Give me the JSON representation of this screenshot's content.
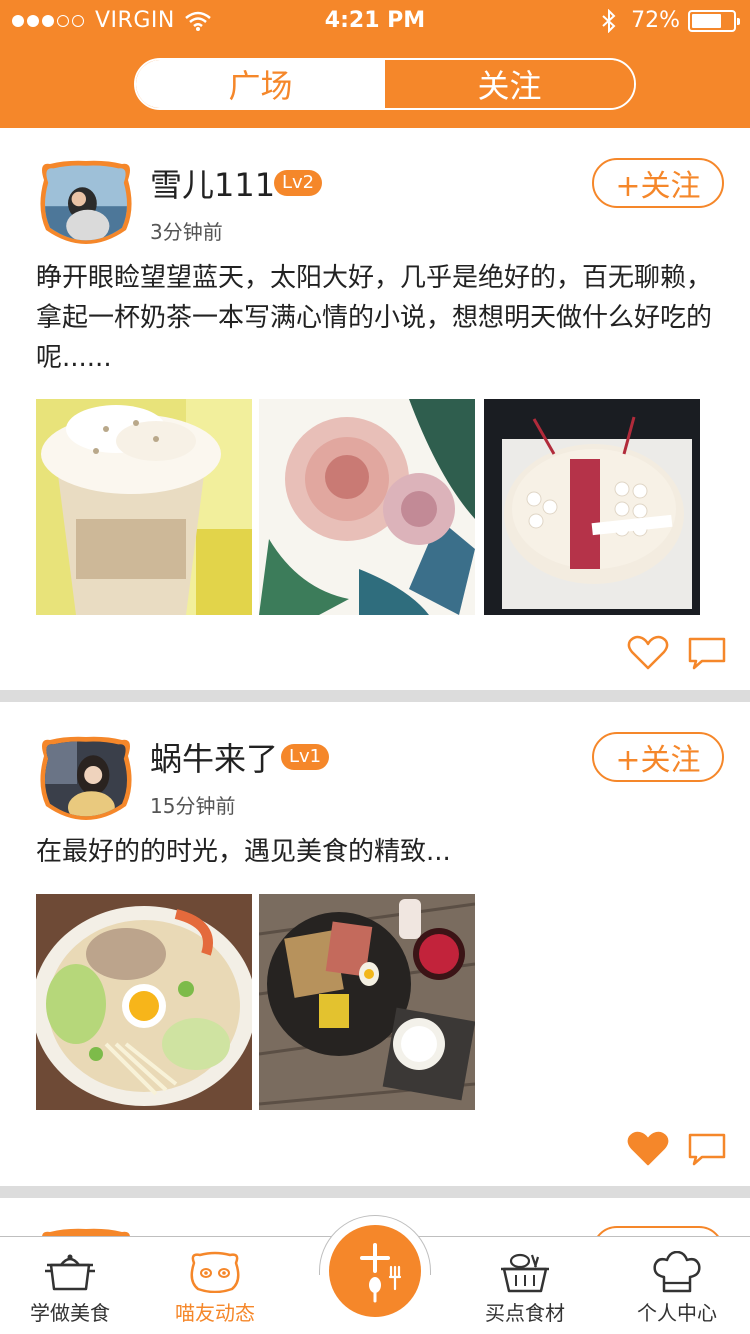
{
  "status_bar": {
    "carrier": "VIRGIN",
    "time": "4:21 PM",
    "battery": "72%",
    "battery_level": 0.72,
    "signal_bars_filled": 3,
    "signal_bars_total": 5
  },
  "header": {
    "tabs": [
      {
        "label": "广场",
        "active": true
      },
      {
        "label": "关注",
        "active": false
      }
    ]
  },
  "posts": [
    {
      "username": "雪儿111",
      "level": "Lv2",
      "time": "3分钟前",
      "follow_label": "+关注",
      "text": "睁开眼睑望望蓝天，太阳大好，几乎是绝好的，百无聊赖，拿起一杯奶茶一本写满心情的小说，想想明天做什么好吃的呢......",
      "images": [
        "iced-milk-tea-photo",
        "watercolor-roses-photo",
        "berry-cake-photo"
      ],
      "liked": false
    },
    {
      "username": "蜗牛来了",
      "level": "Lv1",
      "time": "15分钟前",
      "follow_label": "+关注",
      "text": "在最好的的时光，遇见美食的精致...",
      "images": [
        "noodle-soup-photo",
        "breakfast-plate-photo"
      ],
      "liked": true
    }
  ],
  "tabbar": {
    "items": [
      {
        "label": "学做美食",
        "icon": "pot-icon",
        "active": false
      },
      {
        "label": "喵友动态",
        "icon": "cat-face-icon",
        "active": true
      },
      {
        "label": "",
        "icon": "spoon-fork-plus-icon",
        "active": false
      },
      {
        "label": "买点食材",
        "icon": "basket-icon",
        "active": false
      },
      {
        "label": "个人中心",
        "icon": "chef-hat-icon",
        "active": false
      }
    ]
  },
  "colors": {
    "accent": "#f5872a",
    "divider": "#dcdcdc",
    "text": "#222222"
  }
}
